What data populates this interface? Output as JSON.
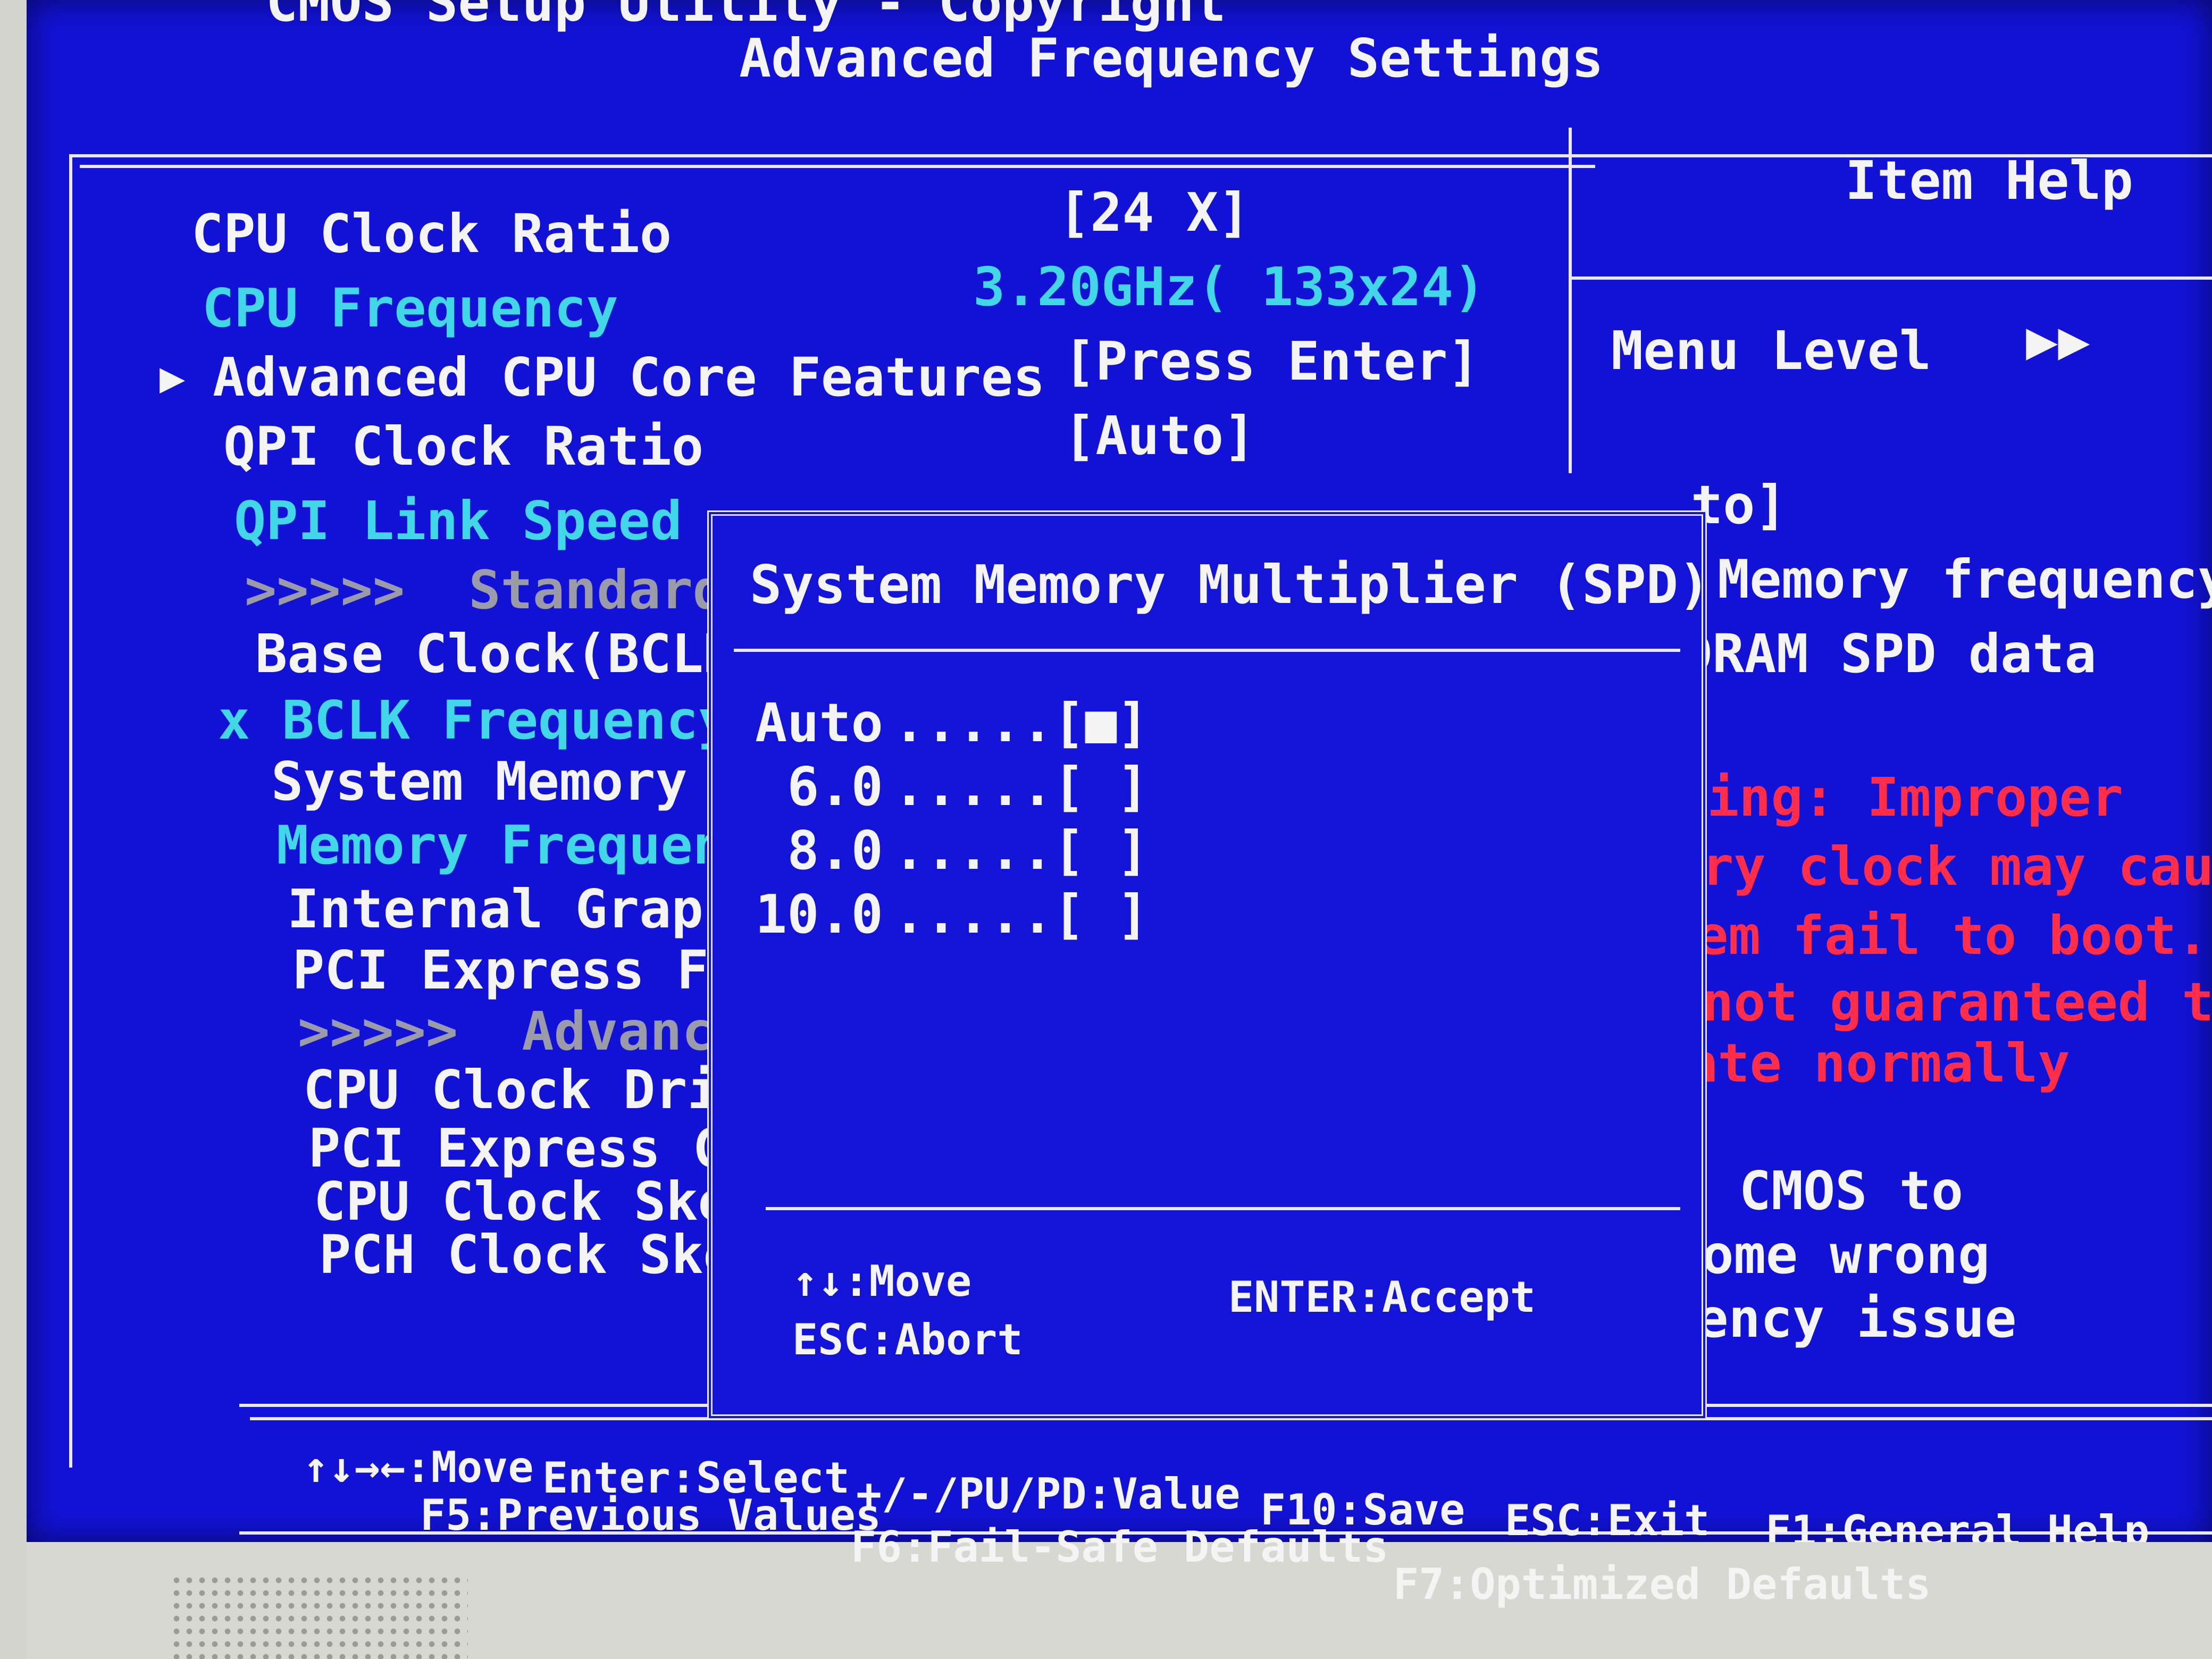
{
  "header": {
    "top_partial": "CMOS Setup Utility - Copyright",
    "title": "Advanced Frequency Settings"
  },
  "menu": {
    "items": [
      {
        "label": "CPU Clock Ratio",
        "value": "[24 X]",
        "style": "white"
      },
      {
        "label": "CPU Frequency",
        "value": "3.20GHz( 133x24)",
        "style": "cyan"
      },
      {
        "label": "Advanced CPU Core Features",
        "value": "[Press Enter]",
        "style": "white",
        "submenu": true
      },
      {
        "label": "QPI Clock Ratio",
        "value": "[Auto]",
        "style": "white"
      },
      {
        "label": "QPI Link Speed",
        "style": "cyan"
      },
      {
        "label": ">>>>>  Standard C",
        "style": "grey"
      },
      {
        "label": "Base Clock(BCLK)",
        "style": "white"
      },
      {
        "label": "x BCLK Frequency(Mh",
        "style": "cyan"
      },
      {
        "label": "System Memory Mul",
        "style": "white"
      },
      {
        "label": "Memory Frequency(",
        "style": "cyan"
      },
      {
        "label": "Internal Graphics",
        "style": "white"
      },
      {
        "label": "PCI Express Frequ",
        "style": "white"
      },
      {
        "label": ">>>>>  Advanced C",
        "style": "grey"
      },
      {
        "label": "CPU Clock Drive",
        "style": "white"
      },
      {
        "label": "PCI Express Clock",
        "style": "white"
      },
      {
        "label": "CPU Clock Skew",
        "style": "white"
      },
      {
        "label": "PCH Clock Skew",
        "style": "white"
      }
    ]
  },
  "item_help": {
    "title": "Item Help",
    "menu_level_label": "Menu Level",
    "menu_level_icon": ">>",
    "lines_white": [
      "to]",
      "Memory frequency",
      "DRAM SPD data"
    ],
    "lines_red": [
      "ning: Improper",
      "ory clock may caus",
      "tem fail to boot.",
      " not guaranteed to",
      "rate normally"
    ],
    "lines_white2": [
      "ar CMOS to",
      "rcome wrong",
      "quency issue"
    ]
  },
  "popup": {
    "title": "System Memory Multiplier (SPD)",
    "options": [
      {
        "label": "Auto",
        "dots": ".....",
        "mark": "[■]",
        "selected": true
      },
      {
        "label": " 6.0",
        "dots": ".....",
        "mark": "[ ]",
        "selected": false
      },
      {
        "label": " 8.0",
        "dots": ".....",
        "mark": "[ ]",
        "selected": false
      },
      {
        "label": "10.0",
        "dots": ".....",
        "mark": "[ ]",
        "selected": false
      }
    ],
    "hint_move": "↑↓:Move",
    "hint_abort": "ESC:Abort",
    "hint_accept": "ENTER:Accept"
  },
  "footer": {
    "row1": [
      "↑↓→←:Move",
      "Enter:Select",
      "+/-/PU/PD:Value",
      "F10:Save",
      "ESC:Exit",
      "F1:General Help"
    ],
    "row2": [
      "F5:Previous Values",
      "F6:Fail-Safe Defaults",
      "F7:Optimized Defaults"
    ]
  },
  "colors": {
    "background": "#1212d6",
    "text_white": "#f4f4f4",
    "text_cyan": "#41d6e8",
    "text_grey": "#9a9aa8",
    "text_red": "#ff2d4a"
  }
}
